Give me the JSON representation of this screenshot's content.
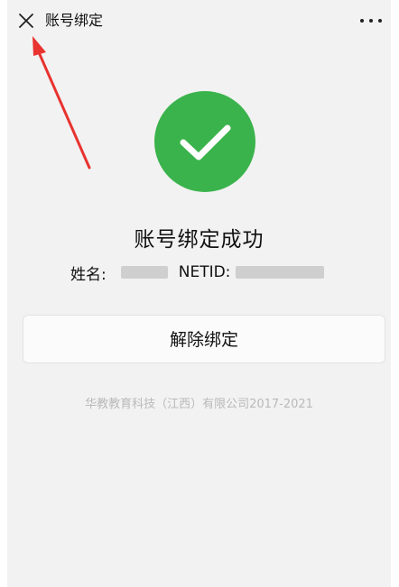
{
  "header": {
    "title": "账号绑定",
    "close_icon": "close-icon",
    "more_icon": "more-dots-icon"
  },
  "status": {
    "icon": "checkmark-icon",
    "icon_color": "#3bb34c",
    "message": "账号绑定成功"
  },
  "account": {
    "name_label": "姓名:",
    "netid_label": "NETID:"
  },
  "actions": {
    "unbind_label": "解除绑定"
  },
  "footer": {
    "copyright": "华教教育科技（江西）有限公司2017-2021"
  },
  "annotation": {
    "arrow_color": "#e8332f"
  }
}
